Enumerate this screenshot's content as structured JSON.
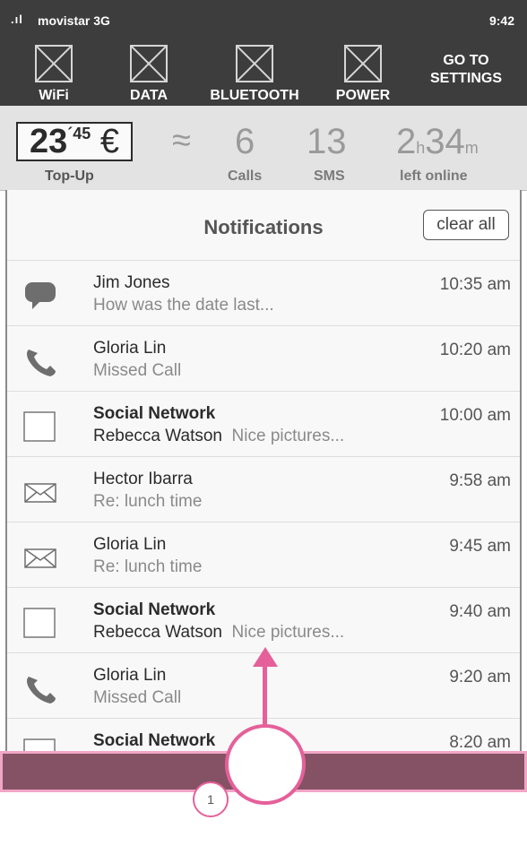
{
  "status_bar": {
    "signal": ".ıl",
    "carrier": "movistar 3G",
    "time": "9:42"
  },
  "quick_toggles": [
    {
      "label": "WiFi"
    },
    {
      "label": "DATA"
    },
    {
      "label": "BLUETOOTH"
    },
    {
      "label": "POWER"
    }
  ],
  "settings": {
    "line1": "GO TO",
    "line2": "SETTINGS"
  },
  "usage": {
    "credit_int": "23",
    "credit_dec": "´45",
    "currency": "€",
    "approx": "≈",
    "calls": "6",
    "sms": "13",
    "hours": "2",
    "hours_unit": "h",
    "minutes": "34",
    "minutes_unit": "m",
    "labels": {
      "topup": "Top-Up",
      "calls": "Calls",
      "sms": "SMS",
      "online": "left online"
    }
  },
  "notifications": {
    "title": "Notifications",
    "clear_label": "clear all",
    "items": [
      {
        "icon": "chat-bubble-icon",
        "title": "Jim Jones",
        "title_bold": false,
        "subtitle": "How was the date last...",
        "time": "10:35 am"
      },
      {
        "icon": "phone-icon",
        "title": "Gloria Lin",
        "title_bold": false,
        "subtitle": "Missed Call",
        "time": "10:20 am"
      },
      {
        "icon": "app-placeholder-icon",
        "title": "Social Network",
        "title_bold": true,
        "sender": "Rebecca Watson",
        "subtitle": "Nice pictures...",
        "time": "10:00 am"
      },
      {
        "icon": "envelope-icon",
        "title": "Hector Ibarra",
        "title_bold": false,
        "subtitle": "Re: lunch time",
        "time": "9:58 am"
      },
      {
        "icon": "envelope-icon",
        "title": "Gloria Lin",
        "title_bold": false,
        "subtitle": "Re: lunch time",
        "time": "9:45 am"
      },
      {
        "icon": "app-placeholder-icon",
        "title": "Social Network",
        "title_bold": true,
        "sender": "Rebecca Watson",
        "subtitle": "Nice pictures...",
        "time": "9:40 am"
      },
      {
        "icon": "phone-icon",
        "title": "Gloria Lin",
        "title_bold": false,
        "subtitle": "Missed Call",
        "time": "9:20 am"
      },
      {
        "icon": "app-placeholder-icon",
        "title": "Social Network",
        "title_bold": true,
        "subtitle": "",
        "time": "8:20 am"
      }
    ]
  },
  "annotation": {
    "step": "1"
  },
  "colors": {
    "bar": "#3d3d3d",
    "accent": "#e5609a",
    "home_bar": "#845264"
  }
}
